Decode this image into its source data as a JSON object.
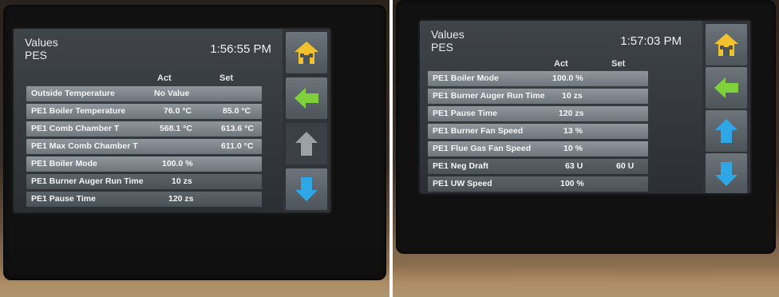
{
  "colors": {
    "home": "#f2c12e",
    "back": "#7fd03a",
    "arrow_on": "#2fa6e6",
    "arrow_off": "#9aa1a7"
  },
  "left": {
    "title_line1": "Values",
    "title_line2": "PES",
    "time": "1:56:55 PM",
    "col_act": "Act",
    "col_set": "Set",
    "rows": [
      {
        "label": "Outside Temperature",
        "act": "No Value",
        "set": ""
      },
      {
        "label": "PE1 Boiler Temperature",
        "act": "76.0 °C",
        "set": "85.0 °C"
      },
      {
        "label": "PE1 Comb Chamber T",
        "act": "568.1 °C",
        "set": "613.6 °C"
      },
      {
        "label": "PE1 Max Comb Chamber T",
        "act": "",
        "set": "611.0 °C"
      },
      {
        "label": "PE1 Boiler Mode",
        "act": "100.0 %",
        "set": ""
      },
      {
        "label": "PE1 Burner Auger Run Time",
        "act": "10 zs",
        "set": ""
      },
      {
        "label": "PE1 Pause Time",
        "act": "120 zs",
        "set": ""
      }
    ]
  },
  "right": {
    "title_line1": "Values",
    "title_line2": "PES",
    "time": "1:57:03 PM",
    "col_act": "Act",
    "col_set": "Set",
    "rows": [
      {
        "label": "PE1 Boiler Mode",
        "act": "100.0 %",
        "set": ""
      },
      {
        "label": "PE1 Burner Auger Run Time",
        "act": "10 zs",
        "set": ""
      },
      {
        "label": "PE1 Pause Time",
        "act": "120 zs",
        "set": ""
      },
      {
        "label": "PE1 Burner Fan Speed",
        "act": "13 %",
        "set": ""
      },
      {
        "label": "PE1 Flue Gas Fan Speed",
        "act": "10 %",
        "set": ""
      },
      {
        "label": "PE1 Neg Draft",
        "act": "63 U",
        "set": "60 U"
      },
      {
        "label": "PE1 UW Speed",
        "act": "100 %",
        "set": ""
      }
    ]
  }
}
